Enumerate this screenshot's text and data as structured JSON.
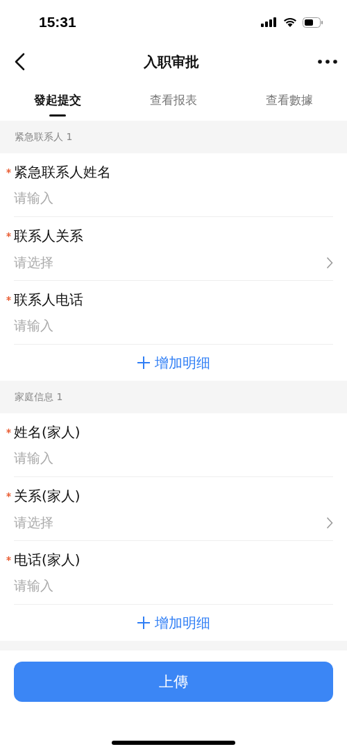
{
  "status_bar": {
    "time": "15:31"
  },
  "nav": {
    "title": "入职审批"
  },
  "tabs": [
    {
      "label": "發起提交",
      "selected": true
    },
    {
      "label": "查看报表",
      "selected": false
    },
    {
      "label": "查看數據",
      "selected": false
    }
  ],
  "sections": [
    {
      "title": "紧急联系人 1",
      "fields": [
        {
          "kind": "input",
          "label": "紧急联系人姓名",
          "required": true,
          "placeholder": "请输入"
        },
        {
          "kind": "select",
          "label": "联系人关系",
          "required": true,
          "placeholder": "请选择"
        },
        {
          "kind": "input",
          "label": "联系人电话",
          "required": true,
          "placeholder": "请输入"
        }
      ],
      "add_button": "增加明细"
    },
    {
      "title": "家庭信息 1",
      "fields": [
        {
          "kind": "input",
          "label": "姓名(家人)",
          "required": true,
          "placeholder": "请输入"
        },
        {
          "kind": "select",
          "label": "关系(家人)",
          "required": true,
          "placeholder": "请选择"
        },
        {
          "kind": "input",
          "label": "电话(家人)",
          "required": true,
          "placeholder": "请输入"
        }
      ],
      "add_button": "增加明细"
    }
  ],
  "submit_button": "上傳"
}
